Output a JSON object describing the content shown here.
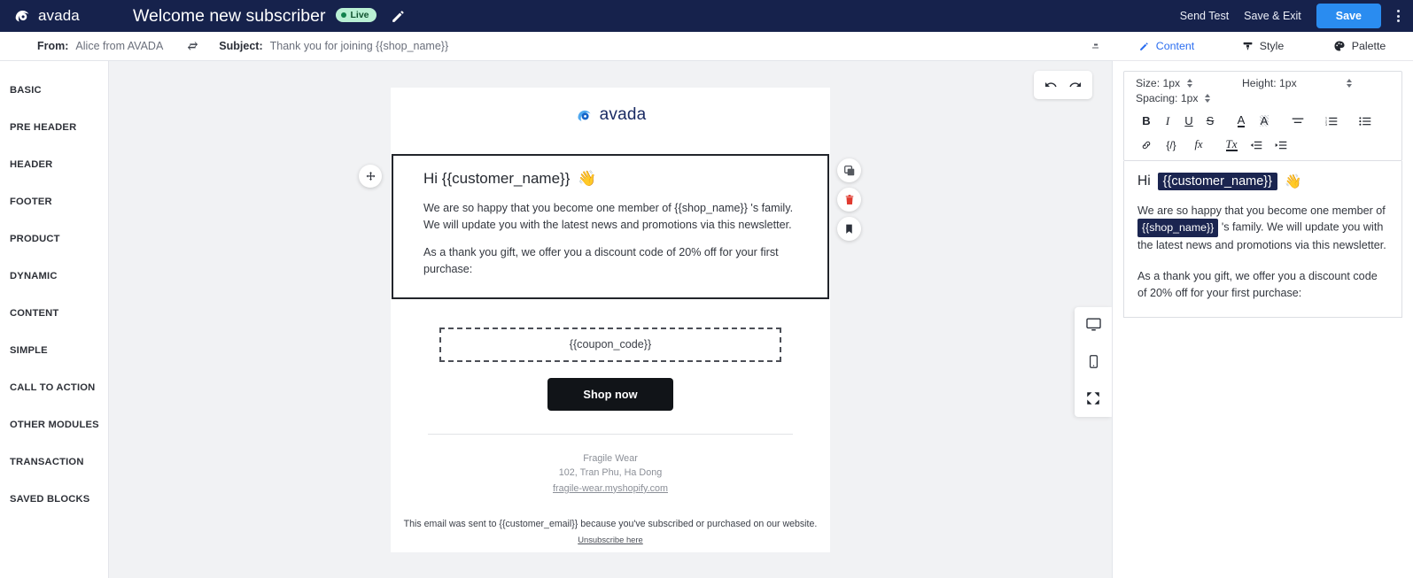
{
  "topbar": {
    "brand": "avada",
    "campaign_title": "Welcome new subscriber",
    "status_badge": "Live",
    "edit_icon": "pencil-icon",
    "send_test": "Send Test",
    "save_exit": "Save & Exit",
    "save": "Save"
  },
  "subject_bar": {
    "from_label": "From:",
    "from_value": "Alice from AVADA",
    "subject_label": "Subject:",
    "subject_value": "Thank you for joining {{shop_name}}"
  },
  "sidebar": {
    "items": [
      {
        "label": "BASIC"
      },
      {
        "label": "PRE HEADER"
      },
      {
        "label": "HEADER"
      },
      {
        "label": "FOOTER"
      },
      {
        "label": "PRODUCT"
      },
      {
        "label": "DYNAMIC"
      },
      {
        "label": "CONTENT"
      },
      {
        "label": "SIMPLE"
      },
      {
        "label": "CALL TO ACTION"
      },
      {
        "label": "OTHER MODULES"
      },
      {
        "label": "TRANSACTION"
      },
      {
        "label": "SAVED BLOCKS"
      }
    ]
  },
  "canvas": {
    "undo": "undo-icon",
    "redo": "redo-icon",
    "email": {
      "logo_text": "avada",
      "greeting": "Hi {{customer_name}}",
      "greeting_emoji": "👋",
      "paragraph_1": "We are so happy that you become one member of {{shop_name}} 's family. We will update you with the latest news and promotions via this newsletter.",
      "paragraph_2": "As a thank you gift, we offer you a discount code of 20% off for your first purchase:",
      "coupon_code": "{{coupon_code}}",
      "cta_button": "Shop now",
      "footer_company": "Fragile Wear",
      "footer_address": "102, Tran Phu, Ha Dong",
      "footer_website": "fragile-wear.myshopify.com",
      "legal_text": "This email was sent to {{customer_email}} because you've subscribed or purchased on our website.",
      "unsubscribe": "Unsubscribe here"
    },
    "block_actions": {
      "duplicate": "duplicate-icon",
      "delete": "trash-icon",
      "bookmark": "bookmark-icon",
      "move": "move-icon"
    },
    "devices": {
      "desktop": "desktop-icon",
      "mobile": "mobile-icon",
      "fullscreen": "fullscreen-icon"
    }
  },
  "right_panel": {
    "tabs": [
      {
        "label": "Content",
        "icon": "pencil-icon",
        "active": true
      },
      {
        "label": "Style",
        "icon": "brush-icon",
        "active": false
      },
      {
        "label": "Palette",
        "icon": "palette-icon",
        "active": false
      }
    ],
    "controls": {
      "size_label": "Size:",
      "size_value": "1px",
      "height_label": "Height:",
      "height_value": "1px",
      "spacing_label": "Spacing:",
      "spacing_value": "1px"
    },
    "toolbar_row1": [
      {
        "name": "bold",
        "glyph": "B"
      },
      {
        "name": "italic",
        "glyph": "I"
      },
      {
        "name": "underline",
        "glyph": "U"
      },
      {
        "name": "strikethrough",
        "glyph": "S"
      },
      {
        "name": "text-color",
        "glyph": "A"
      },
      {
        "name": "highlight-color",
        "glyph": "A"
      },
      {
        "name": "align",
        "glyph": "≡"
      },
      {
        "name": "ordered-list",
        "glyph": "☰"
      },
      {
        "name": "unordered-list",
        "glyph": "☰"
      }
    ],
    "toolbar_row2": [
      {
        "name": "link",
        "glyph": "🔗"
      },
      {
        "name": "code",
        "glyph": "{/}"
      },
      {
        "name": "function",
        "glyph": "fx"
      },
      {
        "name": "clear-format",
        "glyph": "Tx"
      },
      {
        "name": "indent",
        "glyph": "⇥"
      },
      {
        "name": "outdent",
        "glyph": "⇤"
      }
    ],
    "preview": {
      "greeting_prefix": "Hi",
      "greeting_tag": "{{customer_name}}",
      "greeting_emoji": "👋",
      "p1_before": "We are so happy that you become one member of",
      "p1_tag": "{{shop_name}}",
      "p1_after": "'s family. We will update you with the latest news and promotions via this newsletter.",
      "p2": "As a thank you gift, we offer you a discount code of 20% off for your first purchase:"
    }
  },
  "colors": {
    "navy": "#16224c",
    "accent_blue": "#2a8cf0",
    "tab_blue": "#2a6df0",
    "live_green": "#12824d",
    "danger_red": "#e03a2f",
    "canvas_bg": "#f1f2f4"
  }
}
